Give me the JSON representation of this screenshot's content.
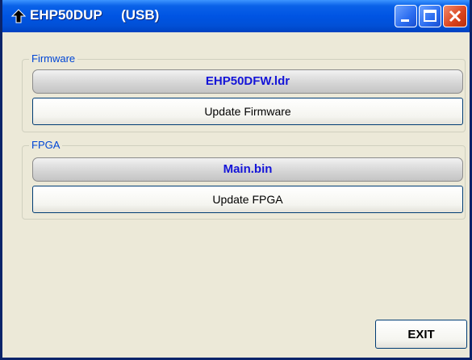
{
  "window": {
    "title": "EHP50DUP     (USB)",
    "icon": "arrow-up-icon",
    "controls": [
      "minimize-icon",
      "maximize-icon",
      "close-icon"
    ]
  },
  "firmware": {
    "group_label": "Firmware",
    "file_name": "EHP50DFW.ldr",
    "button_label": "Update Firmware"
  },
  "fpga": {
    "group_label": "FPGA",
    "file_name": "Main.bin",
    "button_label": "Update FPGA"
  },
  "exit_button_label": "EXIT",
  "colors": {
    "titlebar": "#0054e3",
    "file_text": "#1414d8",
    "group_label": "#0046d5",
    "background": "#ece9d8"
  }
}
